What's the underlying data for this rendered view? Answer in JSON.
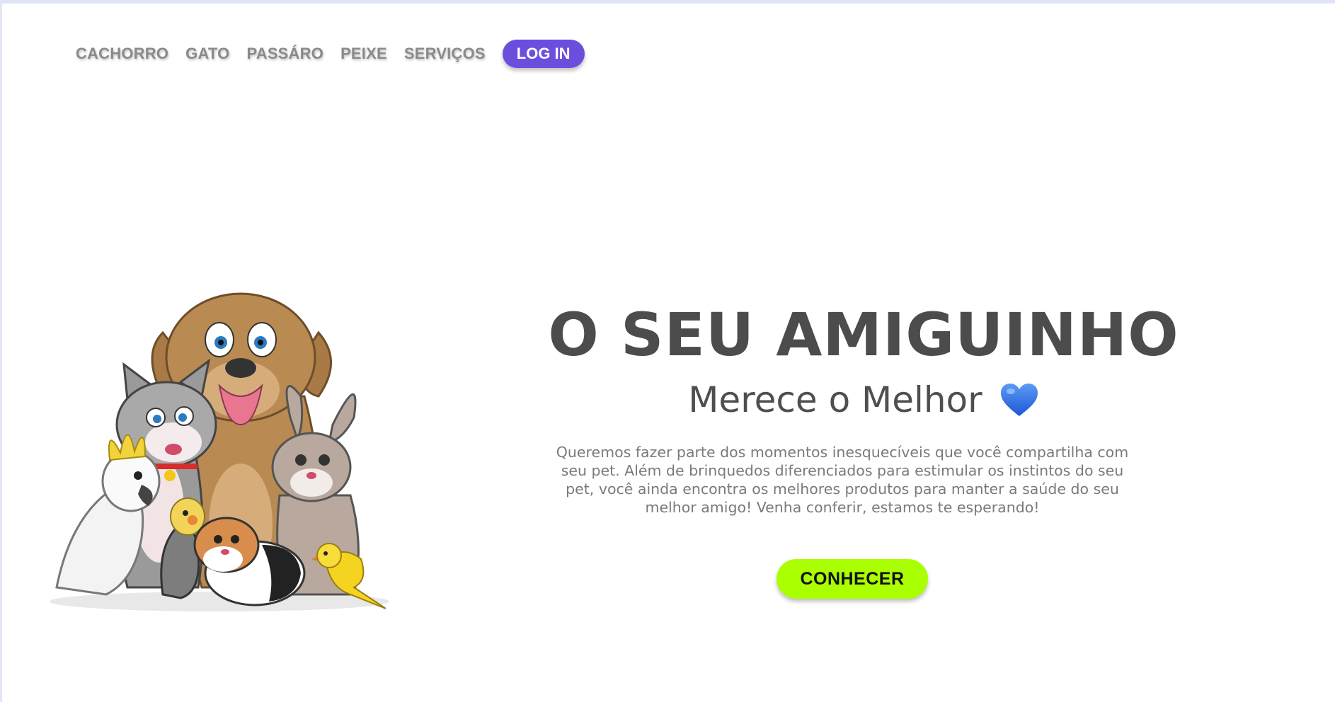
{
  "nav": {
    "items": [
      {
        "label": "CACHORRO"
      },
      {
        "label": "GATO"
      },
      {
        "label": "PASSÁRO"
      },
      {
        "label": "PEIXE"
      },
      {
        "label": "SERVIÇOS"
      }
    ],
    "login_label": "LOG IN"
  },
  "hero": {
    "title": "O SEU AMIGUINHO",
    "subtitle": "Merece o Melhor",
    "subtitle_icon": "blue-heart-icon",
    "description": "Queremos fazer parte dos momentos inesquecíveis que você compartilha com seu pet. Além de brinquedos diferenciados para estimular os instintos do seu pet, você ainda encontra os melhores produtos para manter a saúde do seu melhor amigo! Venha conferir, estamos te esperando!",
    "cta_label": "CONHECER",
    "illustration": "pets-group-illustration"
  },
  "colors": {
    "nav_text": "#8a8a8a",
    "login_bg": "#6b4fdc",
    "title": "#4c4c4c",
    "cta_bg": "#aaff00",
    "heart": "#2f6ee8"
  }
}
